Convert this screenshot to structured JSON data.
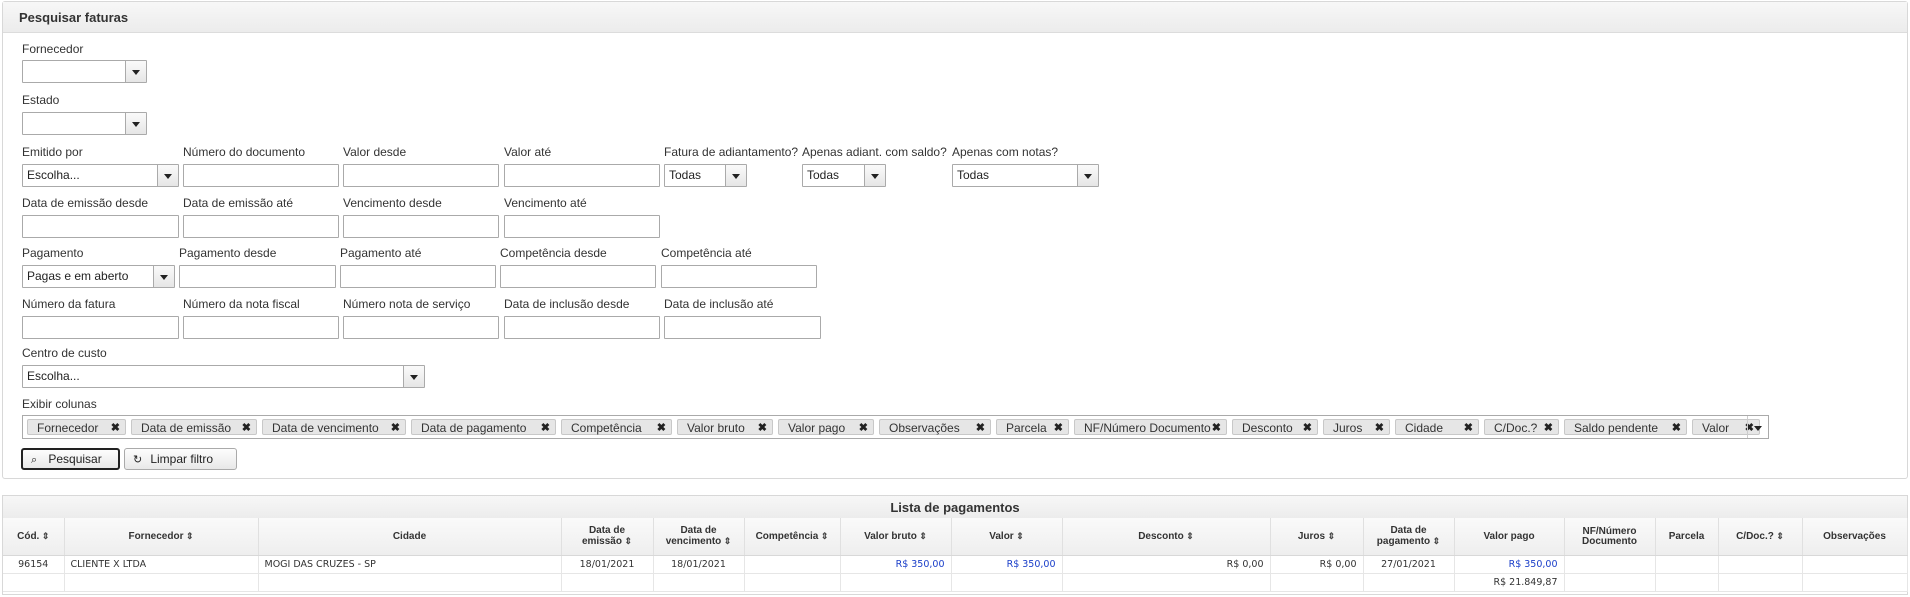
{
  "panel_title": "Pesquisar faturas",
  "filters": {
    "fornecedor": {
      "label": "Fornecedor",
      "value": ""
    },
    "estado": {
      "label": "Estado",
      "value": ""
    },
    "emitido_por": {
      "label": "Emitido por",
      "value": "Escolha..."
    },
    "numero_documento": {
      "label": "Número do documento",
      "value": ""
    },
    "valor_desde": {
      "label": "Valor desde",
      "value": ""
    },
    "valor_ate": {
      "label": "Valor até",
      "value": ""
    },
    "fatura_adiantamento": {
      "label": "Fatura de adiantamento?",
      "value": "Todas"
    },
    "apenas_adiant": {
      "label": "Apenas adiant. com saldo?",
      "value": "Todas"
    },
    "apenas_notas": {
      "label": "Apenas com notas?",
      "value": "Todas"
    },
    "data_emissao_desde": {
      "label": "Data de emissão desde",
      "value": ""
    },
    "data_emissao_ate": {
      "label": "Data de emissão até",
      "value": ""
    },
    "vencimento_desde": {
      "label": "Vencimento desde",
      "value": ""
    },
    "vencimento_ate": {
      "label": "Vencimento até",
      "value": ""
    },
    "pagamento": {
      "label": "Pagamento",
      "value": "Pagas e em aberto"
    },
    "pagamento_desde": {
      "label": "Pagamento desde",
      "value": ""
    },
    "pagamento_ate": {
      "label": "Pagamento até",
      "value": ""
    },
    "competencia_desde": {
      "label": "Competência desde",
      "value": ""
    },
    "competencia_ate": {
      "label": "Competência até",
      "value": ""
    },
    "numero_fatura": {
      "label": "Número da fatura",
      "value": ""
    },
    "numero_nota_fiscal": {
      "label": "Número da nota fiscal",
      "value": ""
    },
    "numero_nota_servico": {
      "label": "Número nota de serviço",
      "value": ""
    },
    "data_inclusao_desde": {
      "label": "Data de inclusão desde",
      "value": ""
    },
    "data_inclusao_ate": {
      "label": "Data de inclusão até",
      "value": ""
    },
    "centro_custo": {
      "label": "Centro de custo",
      "value": "Escolha..."
    }
  },
  "exibir_colunas": {
    "label": "Exibir colunas",
    "tags": [
      "Fornecedor",
      "Data de emissão",
      "Data de vencimento",
      "Data de pagamento",
      "Competência",
      "Valor bruto",
      "Valor pago",
      "Observações",
      "Parcela",
      "NF/Número Documento",
      "Desconto",
      "Juros",
      "Cidade",
      "C/Doc.?",
      "Saldo pendente",
      "Valor"
    ],
    "remove_glyph": "✖"
  },
  "buttons": {
    "pesquisar": "Pesquisar",
    "limpar": "Limpar filtro"
  },
  "list": {
    "title": "Lista de pagamentos",
    "columns": [
      {
        "line1": "Cód.",
        "line2": "",
        "sort": "⇕"
      },
      {
        "line1": "Fornecedor",
        "line2": "",
        "sort": "⇕"
      },
      {
        "line1": "Cidade",
        "line2": "",
        "sort": ""
      },
      {
        "line1": "Data de",
        "line2": "emissão",
        "sort": "⇕"
      },
      {
        "line1": "Data de",
        "line2": "vencimento",
        "sort": "⇕"
      },
      {
        "line1": "Competência",
        "line2": "",
        "sort": "⇕"
      },
      {
        "line1": "Valor bruto",
        "line2": "",
        "sort": "⇕"
      },
      {
        "line1": "Valor",
        "line2": "",
        "sort": "⇕"
      },
      {
        "line1": "Desconto",
        "line2": "",
        "sort": "⇕"
      },
      {
        "line1": "Juros",
        "line2": "",
        "sort": "⇕"
      },
      {
        "line1": "Data de",
        "line2": "pagamento",
        "sort": "⇕"
      },
      {
        "line1": "Valor pago",
        "line2": "",
        "sort": ""
      },
      {
        "line1": "NF/Número",
        "line2": "Documento",
        "sort": ""
      },
      {
        "line1": "Parcela",
        "line2": "",
        "sort": ""
      },
      {
        "line1": "C/Doc.?",
        "line2": "",
        "sort": "⇕"
      },
      {
        "line1": "Observações",
        "line2": "",
        "sort": ""
      }
    ],
    "rows": [
      [
        "96154",
        "CLIENTE X LTDA",
        "MOGI DAS CRUZES - SP",
        "18/01/2021",
        "18/01/2021",
        "",
        "R$ 350,00",
        "R$ 350,00",
        "R$ 0,00",
        "R$ 0,00",
        "27/01/2021",
        "R$ 350,00",
        "",
        "",
        "",
        ""
      ]
    ],
    "total_valor_pago": "R$ 21.849,87"
  }
}
